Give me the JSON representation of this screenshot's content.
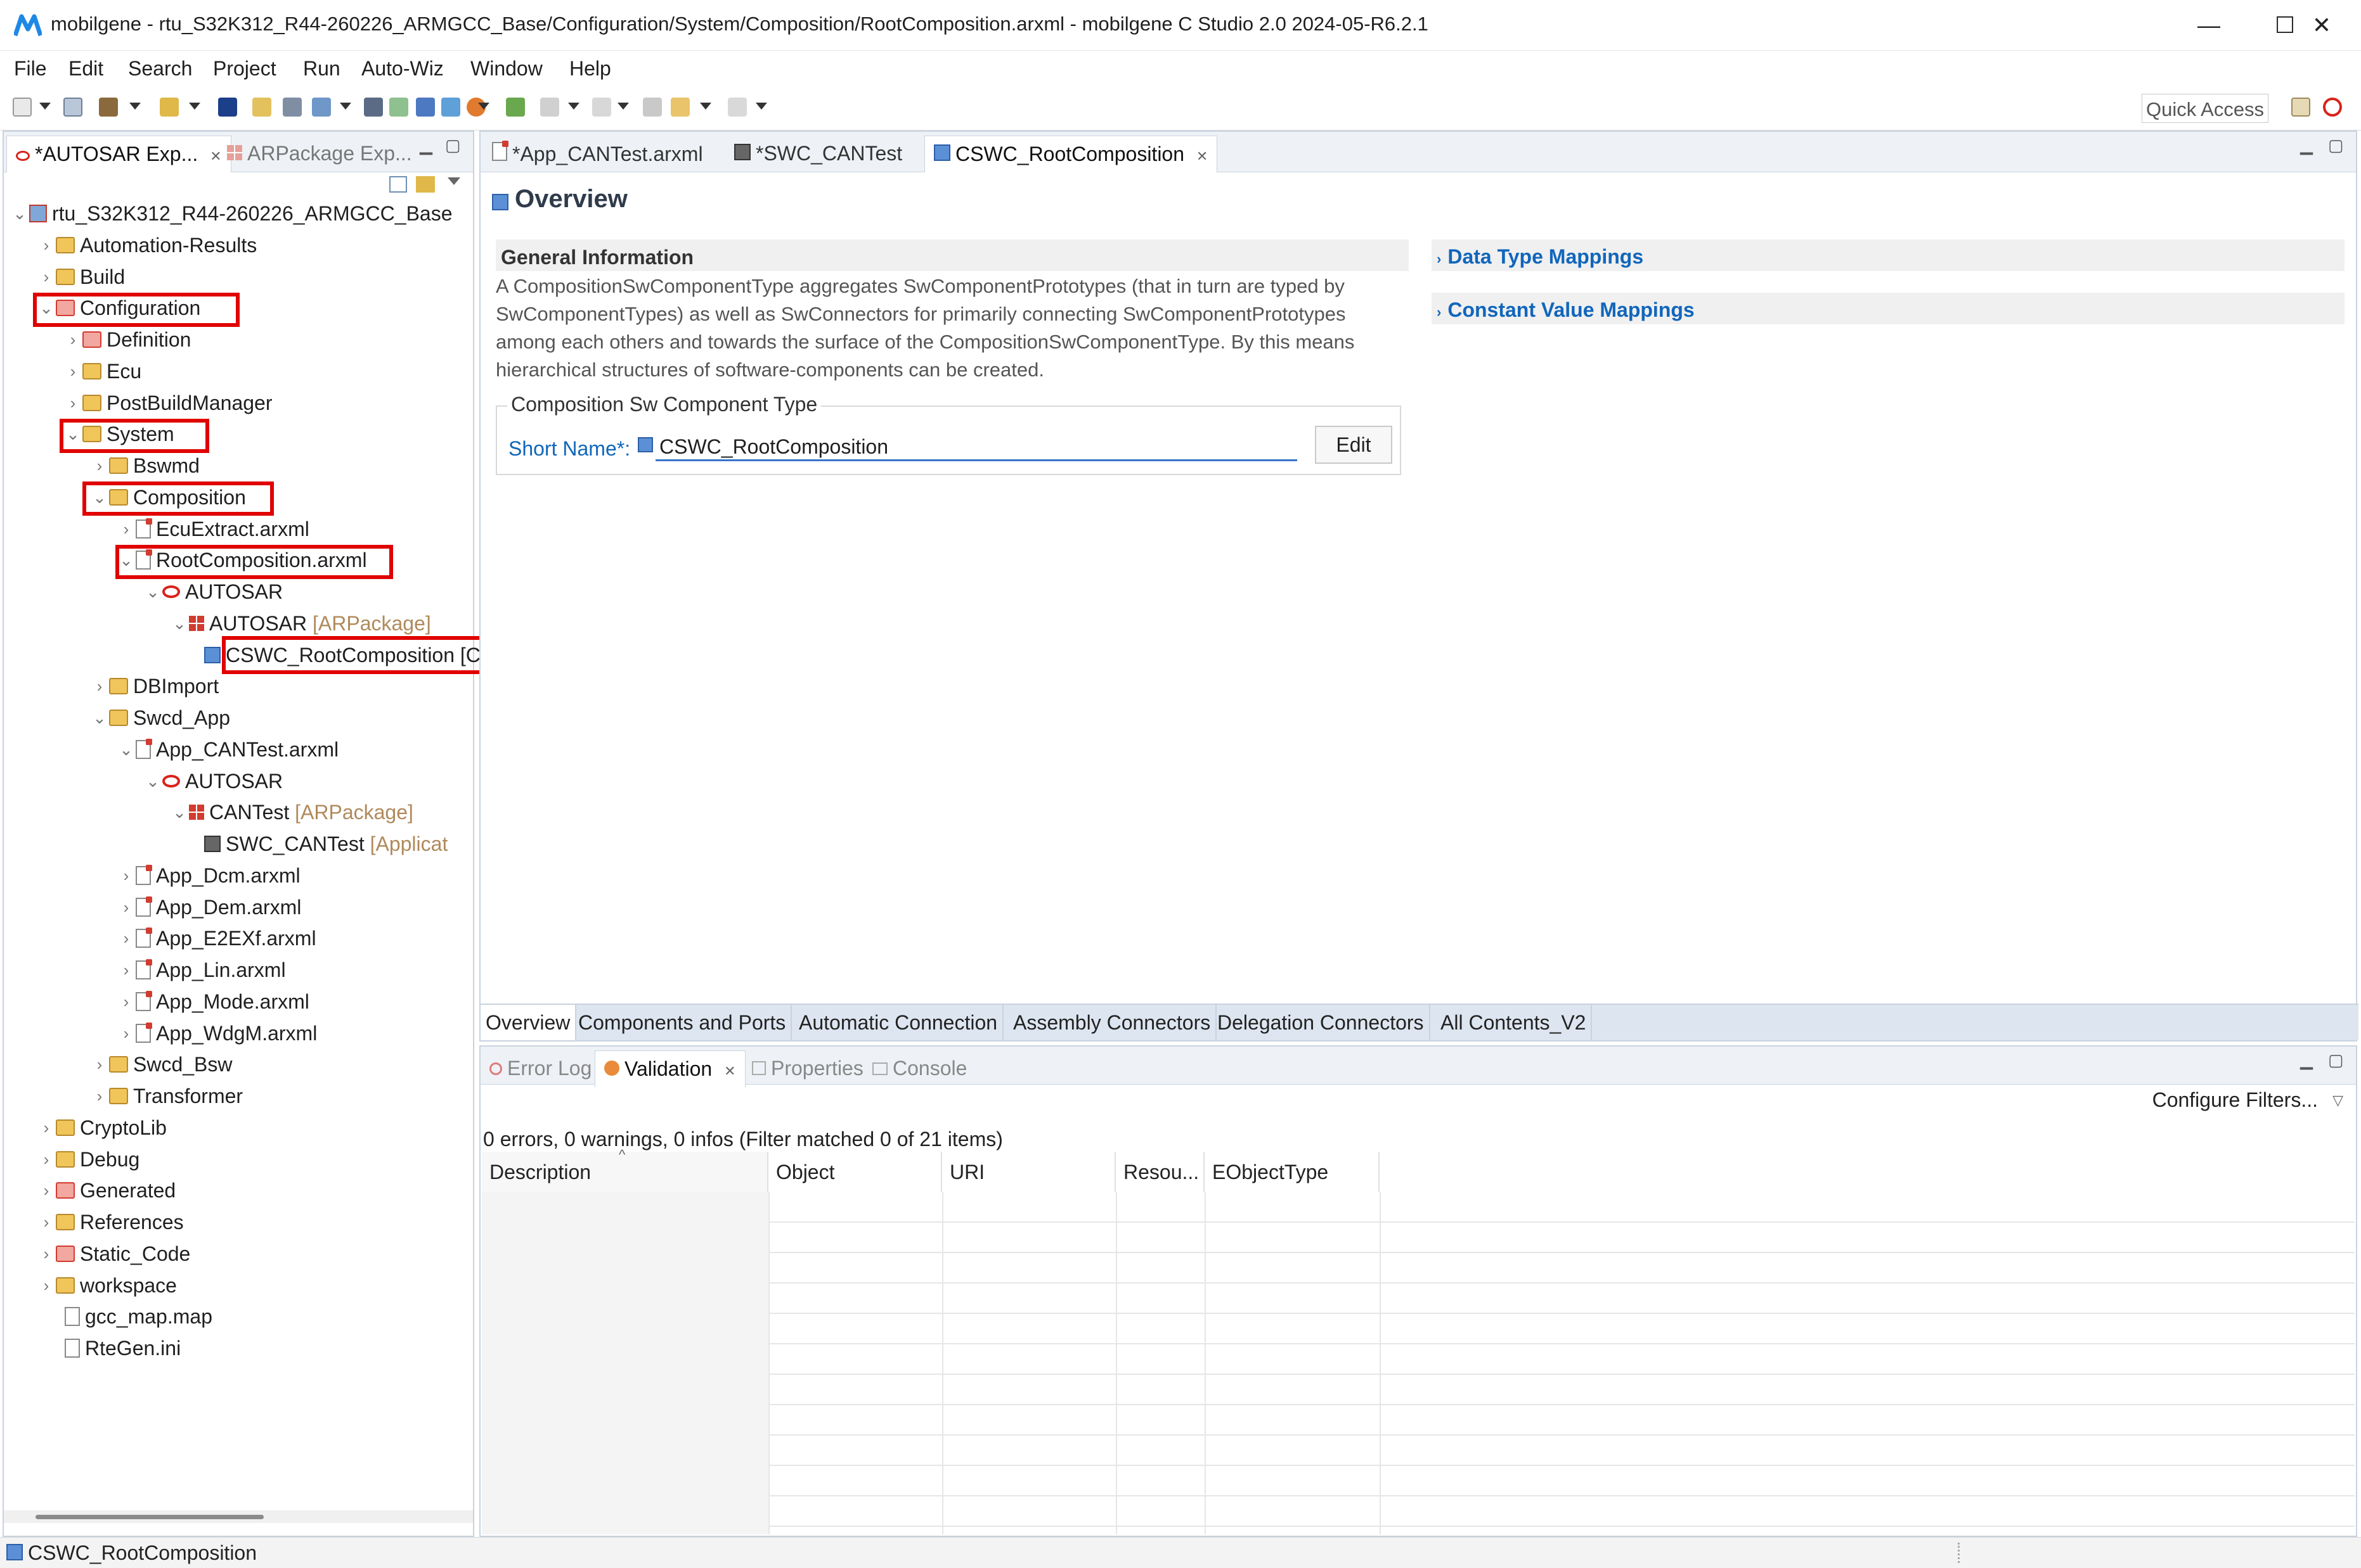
{
  "window": {
    "title": "mobilgene - rtu_S32K312_R44-260226_ARMGCC_Base/Configuration/System/Composition/RootComposition.arxml - mobilgene C Studio 2.0 2024-05-R6.2.1",
    "minimize": "—",
    "maximize": "☐",
    "close": "✕"
  },
  "menu": [
    "File",
    "Edit",
    "Search",
    "Project",
    "Run",
    "Auto-Wiz",
    "Window",
    "Help"
  ],
  "toolbar": {
    "quick_access": "Quick Access"
  },
  "left_panel": {
    "tabs": [
      {
        "label": "*AUTOSAR Exp...",
        "close": "✕"
      },
      {
        "label": "ARPackage Exp..."
      }
    ],
    "tree": [
      {
        "label": "rtu_S32K312_R44-260226_ARMGCC_Base"
      },
      {
        "label": "Automation-Results"
      },
      {
        "label": "Build"
      },
      {
        "label": "Configuration"
      },
      {
        "label": "Definition"
      },
      {
        "label": "Ecu"
      },
      {
        "label": "PostBuildManager"
      },
      {
        "label": "System"
      },
      {
        "label": "Bswmd"
      },
      {
        "label": "Composition"
      },
      {
        "label": "EcuExtract.arxml"
      },
      {
        "label": "RootComposition.arxml"
      },
      {
        "label": "AUTOSAR"
      },
      {
        "label": "AUTOSAR",
        "suffix": "[ARPackage]"
      },
      {
        "label": "CSWC_RootComposition [CompositionSwComponentType]"
      },
      {
        "label": "DBImport"
      },
      {
        "label": "Swcd_App"
      },
      {
        "label": "App_CANTest.arxml"
      },
      {
        "label": "AUTOSAR"
      },
      {
        "label": "CANTest",
        "suffix": "[ARPackage]"
      },
      {
        "label": "SWC_CANTest",
        "suffix": "[Applicat"
      },
      {
        "label": "App_Dcm.arxml"
      },
      {
        "label": "App_Dem.arxml"
      },
      {
        "label": "App_E2EXf.arxml"
      },
      {
        "label": "App_Lin.arxml"
      },
      {
        "label": "App_Mode.arxml"
      },
      {
        "label": "App_WdgM.arxml"
      },
      {
        "label": "Swcd_Bsw"
      },
      {
        "label": "Transformer"
      },
      {
        "label": "CryptoLib"
      },
      {
        "label": "Debug"
      },
      {
        "label": "Generated"
      },
      {
        "label": "References"
      },
      {
        "label": "Static_Code"
      },
      {
        "label": "workspace"
      },
      {
        "label": "gcc_map.map"
      },
      {
        "label": "RteGen.ini"
      }
    ]
  },
  "editor": {
    "tabs": [
      {
        "label": "*App_CANTest.arxml"
      },
      {
        "label": "*SWC_CANTest"
      },
      {
        "label": "CSWC_RootComposition",
        "close": "✕"
      }
    ],
    "overview_title": "Overview",
    "general_info": {
      "title": "General Information",
      "description": "A CompositionSwComponentType aggregates SwComponentPrototypes (that in turn are typed by SwComponentTypes) as well as SwConnectors for primarily connecting SwComponentPrototypes among each others and towards the surface of the CompositionSwComponentType. By this means hierarchical structures of software-components can be created.",
      "group_title": "Composition Sw Component Type",
      "short_name_label": "Short Name*:",
      "short_name_value": "CSWC_RootComposition",
      "edit_button": "Edit"
    },
    "right_sections": [
      "Data Type Mappings",
      "Constant Value Mappings"
    ],
    "page_tabs": [
      "Overview",
      "Components and Ports",
      "Automatic Connection",
      "Assembly Connectors",
      "Delegation Connectors",
      "All Contents_V2"
    ]
  },
  "bottom_panel": {
    "tabs": [
      {
        "label": "Error Log"
      },
      {
        "label": "Validation",
        "close": "✕"
      },
      {
        "label": "Properties"
      },
      {
        "label": "Console"
      }
    ],
    "summary": "0 errors, 0 warnings, 0 infos (Filter matched 0 of 21 items)",
    "configure_filters": "Configure Filters...",
    "columns": [
      "Description",
      "Object",
      "URI",
      "Resou...",
      "EObjectType"
    ]
  },
  "status_bar": {
    "selection": "CSWC_RootComposition"
  },
  "colors": {
    "highlight": "#e00000",
    "link": "#1166bb",
    "accent": "#3574c7"
  }
}
